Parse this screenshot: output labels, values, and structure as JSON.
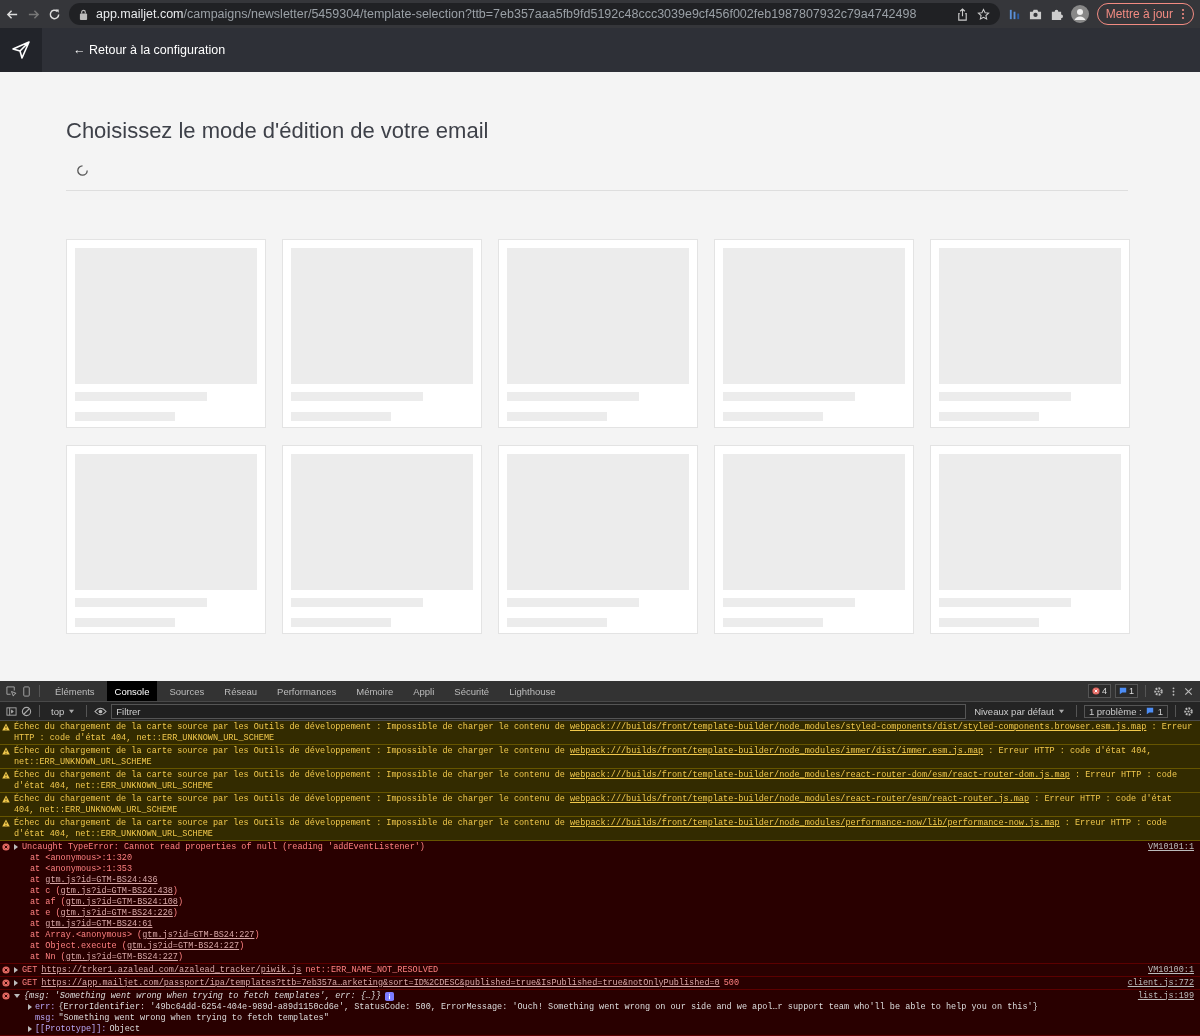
{
  "browser": {
    "url_host": "app.mailjet.com",
    "url_path": "/campaigns/newsletter/5459304/template-selection?ttb=7eb357aaa5fb9fd5192c48ccc3039e9cf456f002feb1987807932c79a4742498",
    "update_button": "Mettre à jour"
  },
  "app_header": {
    "back_link": "← Retour à la configuration"
  },
  "page": {
    "title": "Choisissez le mode d'édition de votre email",
    "loading": true,
    "template_cards": [
      {
        "kind": "placeholder"
      },
      {
        "kind": "placeholder"
      },
      {
        "kind": "placeholder"
      },
      {
        "kind": "placeholder"
      },
      {
        "kind": "placeholder"
      },
      {
        "kind": "placeholder"
      },
      {
        "kind": "placeholder"
      },
      {
        "kind": "placeholder"
      },
      {
        "kind": "placeholder"
      },
      {
        "kind": "placeholder"
      }
    ]
  },
  "devtools": {
    "tabs": [
      {
        "label": "Éléments",
        "selected": false
      },
      {
        "label": "Console",
        "selected": true
      },
      {
        "label": "Sources",
        "selected": false
      },
      {
        "label": "Réseau",
        "selected": false
      },
      {
        "label": "Performances",
        "selected": false
      },
      {
        "label": "Mémoire",
        "selected": false
      },
      {
        "label": "Appli",
        "selected": false
      },
      {
        "label": "Sécurité",
        "selected": false
      },
      {
        "label": "Lighthouse",
        "selected": false
      }
    ],
    "error_count": "4",
    "message_count": "1",
    "context": "top",
    "filter_placeholder": "Filtrer",
    "levels": "Niveaux par défaut",
    "issues_label": "1 problème :",
    "issues_count": "1"
  },
  "console": [
    {
      "kind": "warning",
      "text": "Échec du chargement de la carte source par les Outils de développement : Impossible de charger le contenu de ",
      "link": "webpack:///builds/front/template-builder/node_modules/styled-components/dist/styled-components.browser.esm.js.map",
      "suffix": " : Erreur HTTP : code d'état 404, net::ERR_UNKNOWN_URL_SCHEME"
    },
    {
      "kind": "warning",
      "text": "Échec du chargement de la carte source par les Outils de développement : Impossible de charger le contenu de ",
      "link": "webpack:///builds/front/template-builder/node_modules/immer/dist/immer.esm.js.map",
      "suffix": " : Erreur HTTP : code d'état 404, net::ERR_UNKNOWN_URL_SCHEME"
    },
    {
      "kind": "warning",
      "text": "Échec du chargement de la carte source par les Outils de développement : Impossible de charger le contenu de ",
      "link": "webpack:///builds/front/template-builder/node_modules/react-router-dom/esm/react-router-dom.js.map",
      "suffix": " : Erreur HTTP : code d'état 404, net::ERR_UNKNOWN_URL_SCHEME"
    },
    {
      "kind": "warning",
      "text": "Échec du chargement de la carte source par les Outils de développement : Impossible de charger le contenu de ",
      "link": "webpack:///builds/front/template-builder/node_modules/react-router/esm/react-router.js.map",
      "suffix": " : Erreur HTTP : code d'état 404, net::ERR_UNKNOWN_URL_SCHEME"
    },
    {
      "kind": "warning",
      "text": "Échec du chargement de la carte source par les Outils de développement : Impossible de charger le contenu de ",
      "link": "webpack:///builds/front/template-builder/node_modules/performance-now/lib/performance-now.js.map",
      "suffix": " : Erreur HTTP : code d'état 404, net::ERR_UNKNOWN_URL_SCHEME"
    },
    {
      "kind": "exception",
      "text": "Uncaught TypeError: Cannot read properties of null (reading 'addEventListener')",
      "source": "VM10101:1",
      "stack": [
        {
          "text": "at <anonymous>:1:320"
        },
        {
          "text": "at <anonymous>:1:353"
        },
        {
          "text": "at ",
          "link": "gtm.js?id=GTM-BS24:436"
        },
        {
          "text": "at c (",
          "link": "gtm.js?id=GTM-BS24:438",
          "suffix": ")"
        },
        {
          "text": "at af (",
          "link": "gtm.js?id=GTM-BS24:108",
          "suffix": ")"
        },
        {
          "text": "at e (",
          "link": "gtm.js?id=GTM-BS24:226",
          "suffix": ")"
        },
        {
          "text": "at ",
          "link": "gtm.js?id=GTM-BS24:61"
        },
        {
          "text": "at Array.<anonymous> (",
          "link": "gtm.js?id=GTM-BS24:227",
          "suffix": ")"
        },
        {
          "text": "at Object.execute (",
          "link": "gtm.js?id=GTM-BS24:227",
          "suffix": ")"
        },
        {
          "text": "at Nn (",
          "link": "gtm.js?id=GTM-BS24:227",
          "suffix": ")"
        }
      ]
    },
    {
      "kind": "network",
      "method": "GET",
      "link": "https://trker1.azalead.com/azalead_tracker/piwik.js",
      "status": "net::ERR_NAME_NOT_RESOLVED",
      "source": "VM10100:1"
    },
    {
      "kind": "network",
      "method": "GET",
      "link": "https://app.mailjet.com/passport/ipa/templates?ttb=7eb357a…arketing&sort=ID%2CDESC&published=true&IsPublished=true&notOnlyPublished=0",
      "status": "500",
      "source": "client.js:772"
    },
    {
      "kind": "object",
      "summary": "{msg: 'Something went wrong when trying to fetch templates', err: {…}}",
      "source": "list.js:199",
      "expanded": true,
      "properties": [
        {
          "key": "err:",
          "value": "{ErrorIdentifier: '49bc64dd-6254-404e-989d-a89d1150cd6e', StatusCode: 500, ErrorMessage: 'Ouch! Something went wrong on our side and we apol…r support team who'll be able to help you on this'}",
          "expandable": true
        },
        {
          "key": "msg:",
          "value": "\"Something went wrong when trying to fetch templates\"",
          "expandable": false
        },
        {
          "key": "[[Prototype]]:",
          "value": "Object",
          "expandable": true
        }
      ]
    }
  ]
}
